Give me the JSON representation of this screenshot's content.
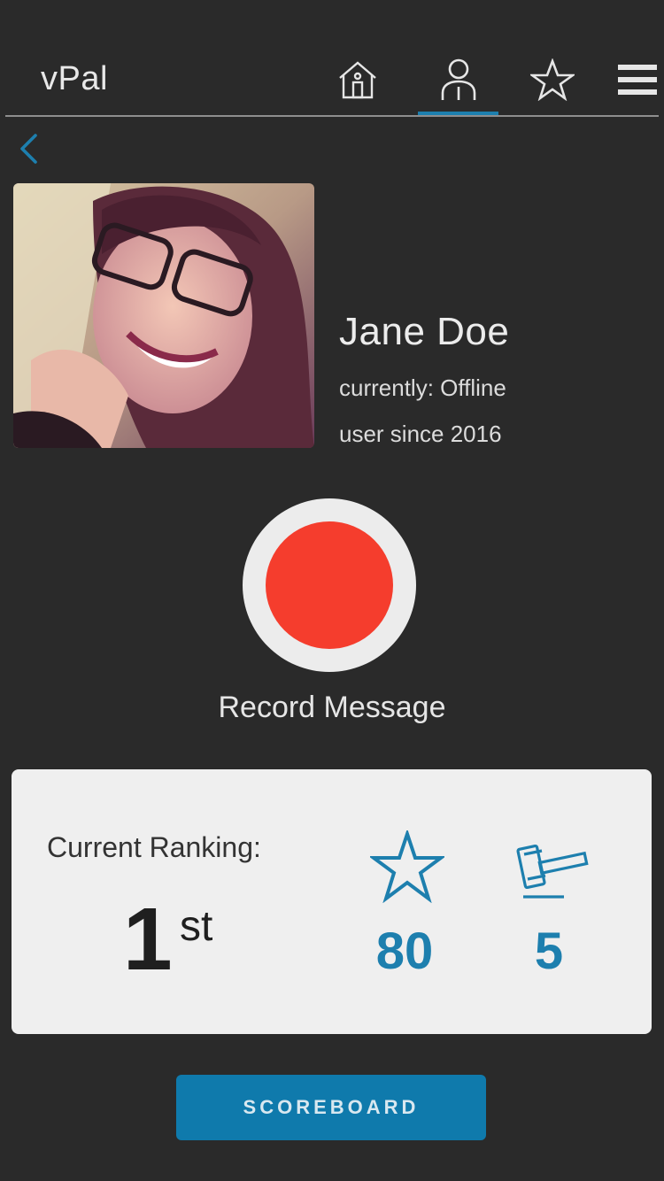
{
  "app": {
    "brand": "vPal"
  },
  "nav": {
    "items": [
      {
        "icon": "home-icon",
        "active": false
      },
      {
        "icon": "profile-icon",
        "active": true
      },
      {
        "icon": "star-icon",
        "active": false
      },
      {
        "icon": "hamburger-menu-icon",
        "active": false
      }
    ],
    "accent": "#1d7fae"
  },
  "profile": {
    "name": "Jane Doe",
    "status": "currently: Offline",
    "since": "user since 2016"
  },
  "record": {
    "label": "Record Message",
    "color": "#f53d2d"
  },
  "ranking": {
    "label": "Current Ranking:",
    "position": "1",
    "suffix": "st",
    "stars": "80",
    "gavels": "5"
  },
  "scoreboard": {
    "label": "SCOREBOARD",
    "color": "#0f7aac"
  }
}
